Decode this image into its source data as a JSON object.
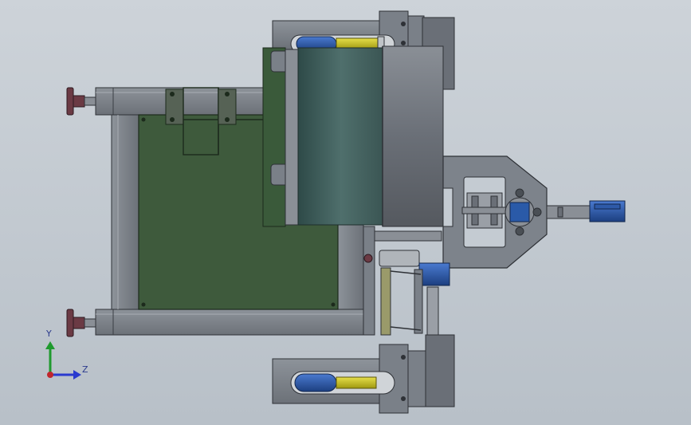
{
  "triad": {
    "y_label": "Y",
    "z_label": "Z",
    "colors": {
      "y_axis": "#1f9a2e",
      "z_axis": "#2a3acf",
      "origin": "#c0262d"
    }
  },
  "palette": {
    "background": "#c4cbd2",
    "frame_steel": "#7a8088",
    "frame_dark": "#4a4f55",
    "panel_green": "#3e5a3c",
    "drum_teal": "#3f5f5c",
    "drum_grey": "#6c7078",
    "cylinder_yellow": "#c8c014",
    "cylinder_blue": "#2a5aa8"
  }
}
